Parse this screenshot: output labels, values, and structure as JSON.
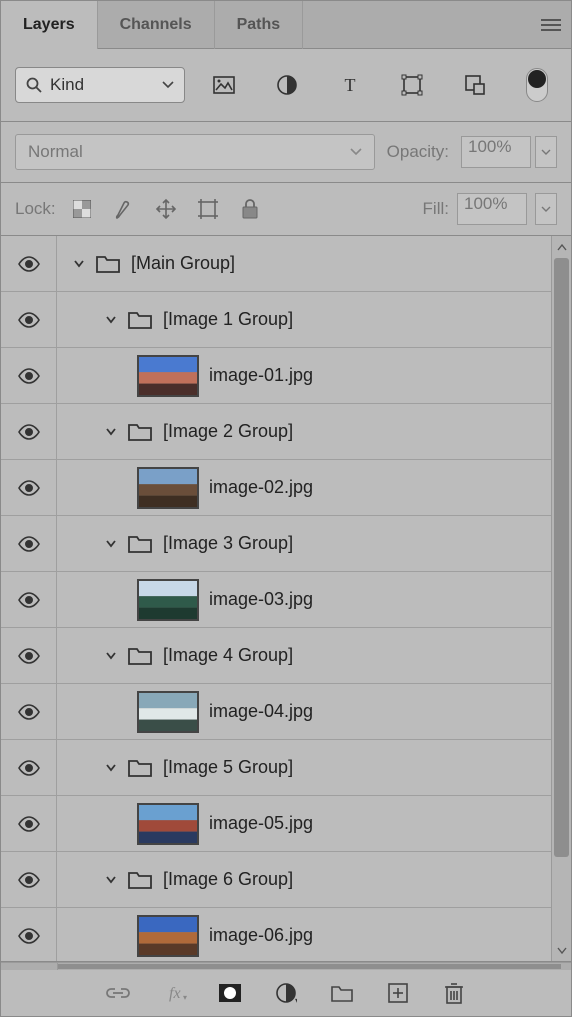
{
  "tabs": {
    "layers": "Layers",
    "channels": "Channels",
    "paths": "Paths"
  },
  "filter": {
    "kind_label": "Kind"
  },
  "blend": {
    "mode": "Normal",
    "opacity_label": "Opacity:",
    "opacity_value": "100%"
  },
  "lock": {
    "label": "Lock:",
    "fill_label": "Fill:",
    "fill_value": "100%"
  },
  "layers": {
    "main_group": "[Main Group]",
    "groups": [
      {
        "group_label": "[Image 1 Group]",
        "file": "image-01.jpg"
      },
      {
        "group_label": "[Image 2 Group]",
        "file": "image-02.jpg"
      },
      {
        "group_label": "[Image 3 Group]",
        "file": "image-03.jpg"
      },
      {
        "group_label": "[Image 4 Group]",
        "file": "image-04.jpg"
      },
      {
        "group_label": "[Image 5 Group]",
        "file": "image-05.jpg"
      },
      {
        "group_label": "[Image 6 Group]",
        "file": "image-06.jpg"
      }
    ]
  },
  "thumbnails": [
    {
      "sky": "#4a7ad0",
      "mid": "#c0705a",
      "ground": "#4a2e2a"
    },
    {
      "sky": "#7aa0c8",
      "mid": "#6a4e3a",
      "ground": "#3e2e22"
    },
    {
      "sky": "#c7d8e8",
      "mid": "#2f5a4a",
      "ground": "#1e3a30"
    },
    {
      "sky": "#88a8b8",
      "mid": "#e0e8e8",
      "ground": "#3a4e48"
    },
    {
      "sky": "#6aa0d0",
      "mid": "#a04a3a",
      "ground": "#2a3a60"
    },
    {
      "sky": "#3a68c0",
      "mid": "#b06a3a",
      "ground": "#5a3a28"
    }
  ]
}
